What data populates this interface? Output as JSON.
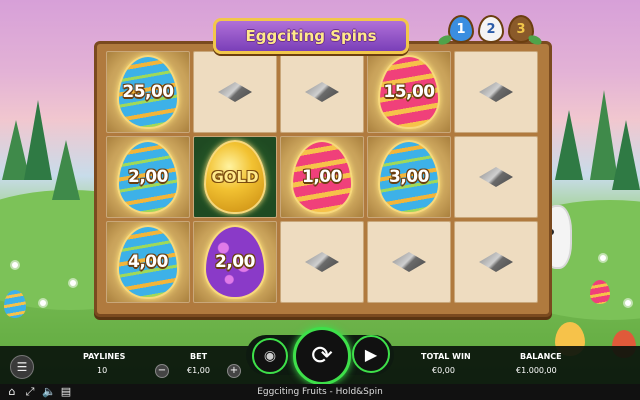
{
  "game": {
    "title": "Eggciting Spins",
    "levels": [
      "1",
      "2",
      "3"
    ],
    "footer_title": "Eggciting Fruits - Hold&Spin"
  },
  "board": {
    "rows": [
      [
        {
          "type": "prize",
          "egg": "blue",
          "value": "25,00"
        },
        {
          "type": "blank"
        },
        {
          "type": "blank"
        },
        {
          "type": "prize",
          "egg": "pink",
          "value": "15,00"
        },
        {
          "type": "blank"
        }
      ],
      [
        {
          "type": "prize",
          "egg": "blue",
          "value": "2,00"
        },
        {
          "type": "gold",
          "egg": "goldegg",
          "value": "GOLD"
        },
        {
          "type": "prize",
          "egg": "pink",
          "value": "1,00"
        },
        {
          "type": "prize",
          "egg": "blue",
          "value": "3,00"
        },
        {
          "type": "blank"
        }
      ],
      [
        {
          "type": "prize",
          "egg": "blue",
          "value": "4,00"
        },
        {
          "type": "prize",
          "egg": "purple",
          "value": "2,00"
        },
        {
          "type": "blank"
        },
        {
          "type": "blank"
        },
        {
          "type": "blank"
        }
      ]
    ]
  },
  "controls": {
    "paylines_label": "PAYLINES",
    "paylines_value": "10",
    "bet_label": "BET",
    "bet_value": "€1,00",
    "minus": "−",
    "plus": "+",
    "total_win_label": "TOTAL WIN",
    "total_win_value": "€0,00",
    "balance_label": "BALANCE",
    "balance_value": "€1.000,00"
  },
  "icons": {
    "menu": "hamburger-icon",
    "spin": "refresh-icon",
    "autoplay": "play-circle-icon",
    "stake": "coins-icon",
    "home": "home-icon",
    "fullscreen": "fullscreen-icon",
    "sound": "speaker-icon",
    "info": "info-icon"
  },
  "colors": {
    "accent_green": "#3ee04a",
    "board_wood": "#b07a3e",
    "banner_purple": "#7a3fb8"
  }
}
